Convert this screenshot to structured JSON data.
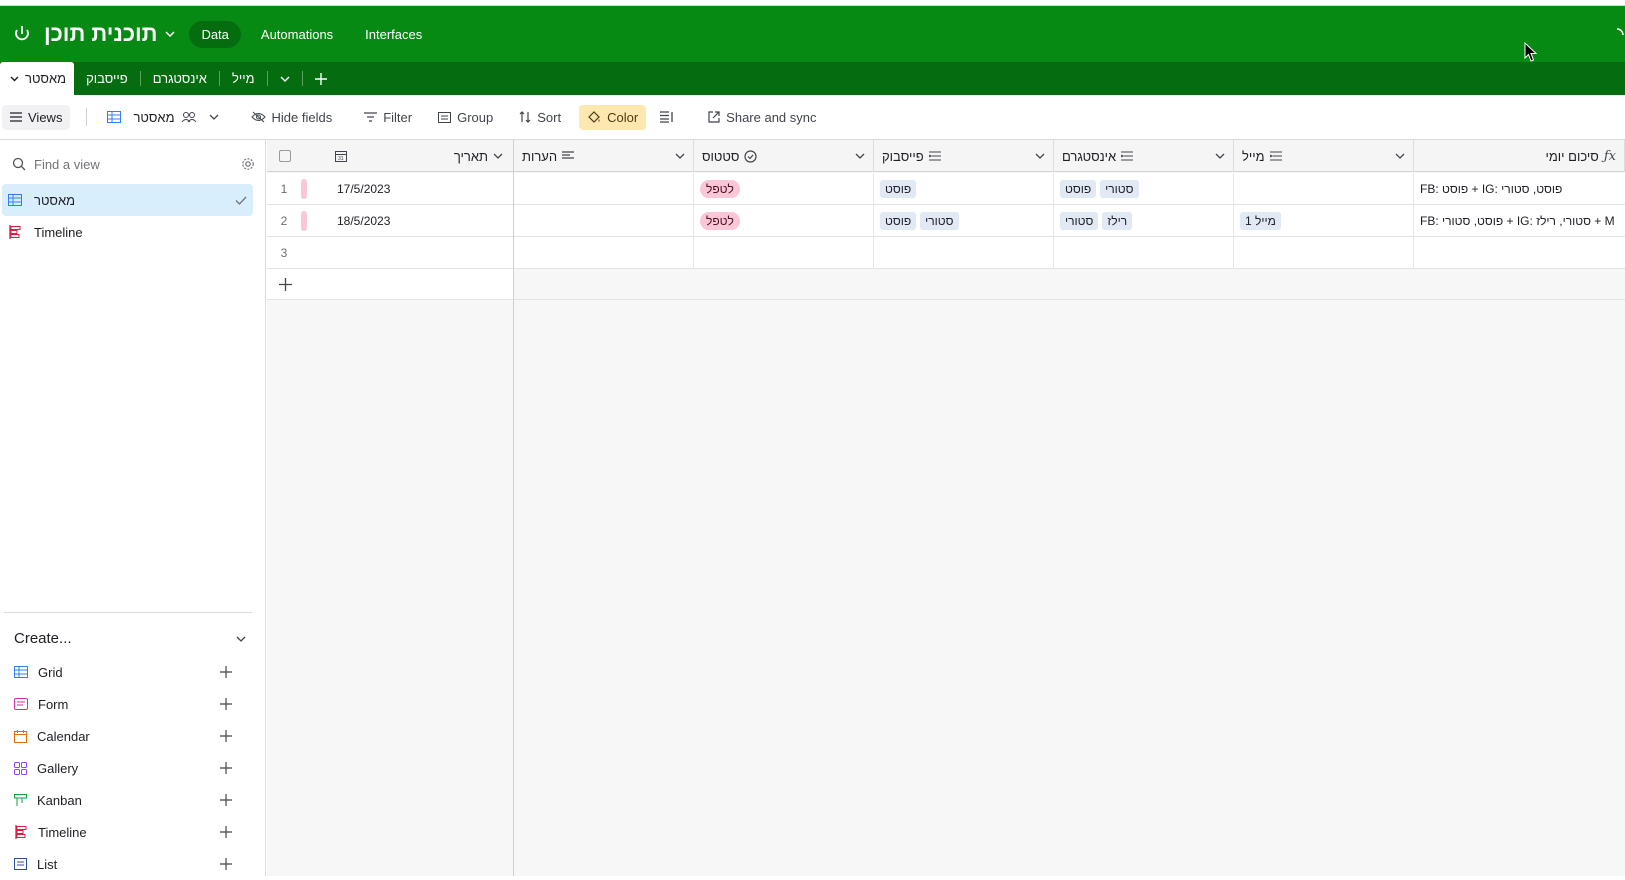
{
  "app": {
    "base_title": "תוכנית תוכן",
    "nav": [
      {
        "label": "Data"
      },
      {
        "label": "Automations"
      },
      {
        "label": "Interfaces"
      }
    ]
  },
  "tables": {
    "items": [
      {
        "label": "מאסטר"
      },
      {
        "label": "פייסבוק"
      },
      {
        "label": "אינסטגרם"
      },
      {
        "label": "מייל"
      }
    ]
  },
  "toolbar": {
    "views_label": "Views",
    "view_name": "מאסטר",
    "hide_fields": "Hide fields",
    "filter": "Filter",
    "group": "Group",
    "sort": "Sort",
    "color": "Color",
    "share": "Share and sync"
  },
  "sidebar": {
    "find_placeholder": "Find a view",
    "views": [
      {
        "label": "מאסטר",
        "icon": "grid-icon"
      },
      {
        "label": "Timeline",
        "icon": "timeline-icon"
      }
    ],
    "create_label": "Create...",
    "create_items": [
      {
        "label": "Grid",
        "color": "#2d7ff9"
      },
      {
        "label": "Form",
        "color": "#d52ea6"
      },
      {
        "label": "Calendar",
        "color": "#e36c09"
      },
      {
        "label": "Gallery",
        "color": "#8b46ff"
      },
      {
        "label": "Kanban",
        "color": "#11a33a"
      },
      {
        "label": "Timeline",
        "color": "#dc1e42"
      },
      {
        "label": "List",
        "color": "#2d4fa0"
      }
    ]
  },
  "grid": {
    "columns": [
      {
        "label": "תאריך",
        "icon": "calendar-icon"
      },
      {
        "label": "הערות",
        "icon": "long-text-icon"
      },
      {
        "label": "סטטוס",
        "icon": "single-select-icon"
      },
      {
        "label": "פייסבוק",
        "icon": "multi-select-icon"
      },
      {
        "label": "אינסטגרם",
        "icon": "multi-select-icon"
      },
      {
        "label": "מייל",
        "icon": "multi-select-icon"
      },
      {
        "label": "סיכום יומי",
        "icon": "formula-icon"
      }
    ],
    "rows": [
      {
        "num": "1",
        "date": "17/5/2023",
        "notes": "",
        "status": "לטפל",
        "facebook": [
          "פוסט"
        ],
        "instagram": [
          "פוסט",
          "סטורי"
        ],
        "mail": [],
        "summary": "FB: פוסט + IG: פוסט, סטורי"
      },
      {
        "num": "2",
        "date": "18/5/2023",
        "notes": "",
        "status": "לטפל",
        "facebook": [
          "פוסט",
          "סטורי"
        ],
        "instagram": [
          "סטורי",
          "רילז"
        ],
        "mail": [
          "מייל 1"
        ],
        "summary": "FB: פוסט, סטורי + IG: סטורי, רילז + M"
      },
      {
        "num": "3",
        "date": "",
        "notes": "",
        "status": "",
        "facebook": [],
        "instagram": [],
        "mail": [],
        "summary": ""
      }
    ],
    "status_color": "#f9c7d5",
    "tag_color": "#e1e9f5"
  },
  "colors": {
    "appbar": "#078a13",
    "tabbar": "#056d0f",
    "selected_view": "#d9eefc"
  }
}
